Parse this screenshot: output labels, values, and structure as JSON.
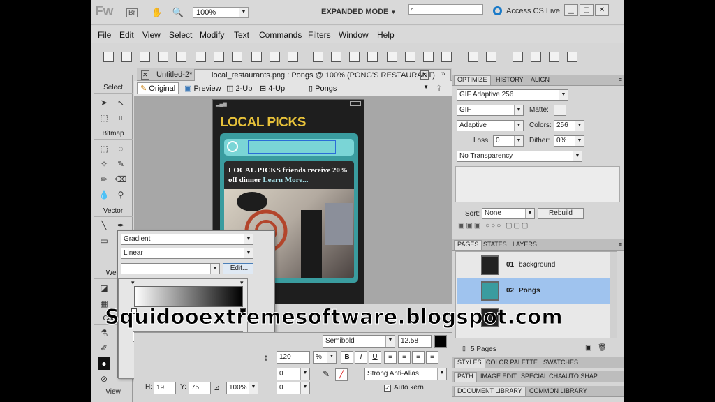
{
  "app": {
    "logo": "Fw",
    "br_label": "Br",
    "zoom": "100%",
    "workspace": "EXPANDED MODE",
    "access_cs_live": "Access CS Live"
  },
  "menu": [
    "File",
    "Edit",
    "View",
    "Select",
    "Modify",
    "Text",
    "Commands",
    "Filters",
    "Window",
    "Help"
  ],
  "tools": {
    "sections": [
      "Select",
      "Bitmap",
      "Vector",
      "Web",
      "Colors",
      "View"
    ]
  },
  "document_tabs": [
    {
      "label": "Untitled-2*"
    },
    {
      "label": "local_restaurants.png : Pongs @ 100% (PONG'S RESTAURANT)"
    }
  ],
  "view_bar": {
    "original": "Original",
    "preview": "Preview",
    "two_up": "2-Up",
    "four_up": "4-Up",
    "page": "Pongs"
  },
  "canvas": {
    "title": "LOCAL PICKS",
    "headline": "LOCAL PICKS friends receive 20% off dinner",
    "link": "Learn More..."
  },
  "optimize": {
    "tabs": [
      "OPTIMIZE",
      "HISTORY",
      "ALIGN"
    ],
    "preset": "GIF Adaptive 256",
    "format": "GIF",
    "matte_label": "Matte:",
    "palette": "Adaptive",
    "colors_label": "Colors:",
    "colors": "256",
    "loss_label": "Loss:",
    "loss": "0",
    "dither_label": "Dither:",
    "dither": "0%",
    "transparency": "No Transparency",
    "sort_label": "Sort:",
    "sort": "None",
    "rebuild": "Rebuild"
  },
  "pages": {
    "tabs": [
      "PAGES",
      "STATES",
      "LAYERS"
    ],
    "items": [
      {
        "num": "01",
        "name": "background"
      },
      {
        "num": "02",
        "name": "Pongs"
      }
    ],
    "count": "5 Pages"
  },
  "bottom_tabs": {
    "row1": [
      "STYLES",
      "COLOR PALETTE",
      "SWATCHES"
    ],
    "row2": [
      "PATH",
      "IMAGE EDIT",
      "SPECIAL CHA",
      "AUTO SHAP"
    ],
    "row3": [
      "DOCUMENT LIBRARY",
      "COMMON LIBRARY"
    ]
  },
  "gradient_popup": {
    "fill_type": "Gradient",
    "gradient_type": "Linear",
    "edit_label": "Edit..."
  },
  "properties": {
    "font_style": "Semibold",
    "font_size": "12.58",
    "leading": "120",
    "leading_unit": "%",
    "kerning": "0",
    "indent": "0",
    "baseline": "0",
    "anti_alias": "Strong Anti-Alias",
    "auto_kern": "Auto kern",
    "h_label": "H:",
    "h_value": "19",
    "y_label": "Y:",
    "y_value": "75",
    "zoom": "100%",
    "bold": "B",
    "italic": "I",
    "underline": "U"
  },
  "watermark": "Squidooextremesoftware.blogspot.com"
}
